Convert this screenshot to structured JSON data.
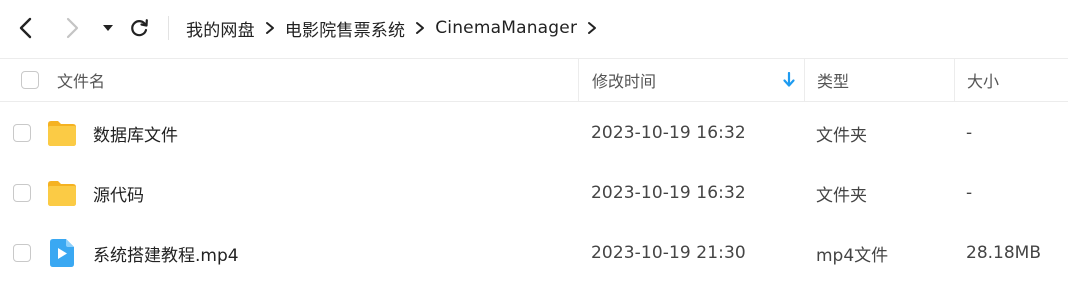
{
  "breadcrumb": [
    {
      "label": "我的网盘"
    },
    {
      "label": "电影院售票系统"
    },
    {
      "label": "CinemaManager"
    }
  ],
  "table": {
    "columns": {
      "name": "文件名",
      "date": "修改时间",
      "type": "类型",
      "size": "大小"
    },
    "sort": {
      "column": "date",
      "direction": "descending",
      "color": "#1e9bf0"
    },
    "rows": [
      {
        "icon": "folder-icon",
        "name": "数据库文件",
        "date": "2023-10-19 16:32",
        "type": "文件夹",
        "size": "-"
      },
      {
        "icon": "folder-icon",
        "name": "源代码",
        "date": "2023-10-19 16:32",
        "type": "文件夹",
        "size": "-"
      },
      {
        "icon": "video-file-icon",
        "name": "系统搭建教程.mp4",
        "date": "2023-10-19 21:30",
        "type": "mp4文件",
        "size": "28.18MB"
      }
    ]
  },
  "colors": {
    "folder": "#f9c534",
    "video": "#3aa8f2",
    "accent": "#1e9bf0"
  }
}
